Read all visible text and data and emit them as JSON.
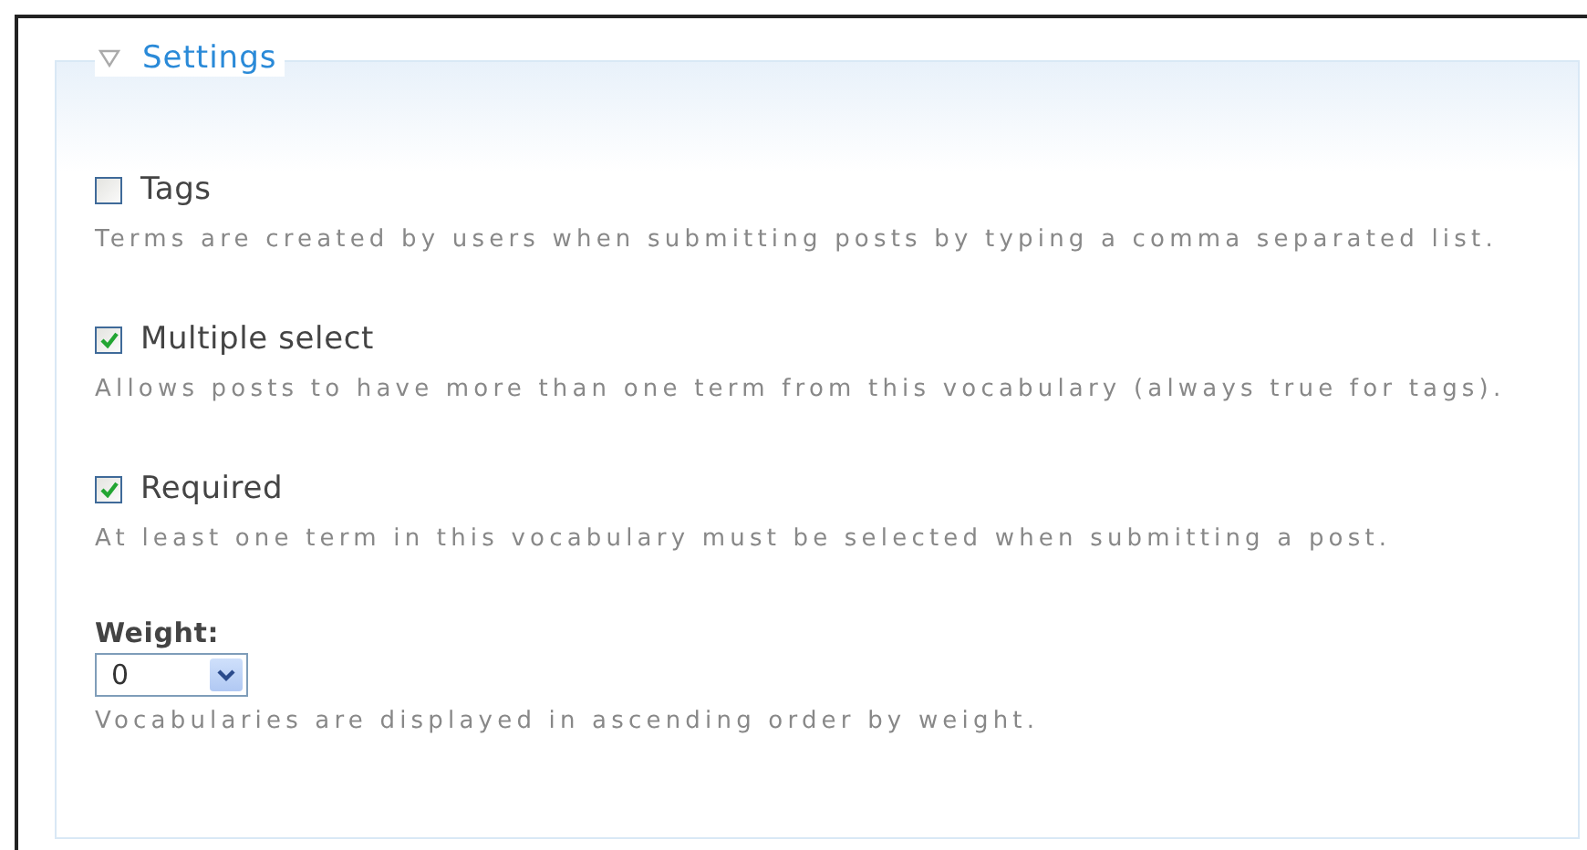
{
  "fieldset": {
    "legend": "Settings",
    "expanded": true
  },
  "options": [
    {
      "label": "Tags",
      "checked": false,
      "description": "Terms are created by users when submitting posts by typing a comma separated list."
    },
    {
      "label": "Multiple select",
      "checked": true,
      "description": "Allows posts to have more than one term from this vocabulary (always true for tags)."
    },
    {
      "label": "Required",
      "checked": true,
      "description": "At least one term in this vocabulary must be selected when submitting a post."
    }
  ],
  "weight": {
    "label": "Weight:",
    "value": "0",
    "description": "Vocabularies are displayed in ascending order by weight."
  }
}
